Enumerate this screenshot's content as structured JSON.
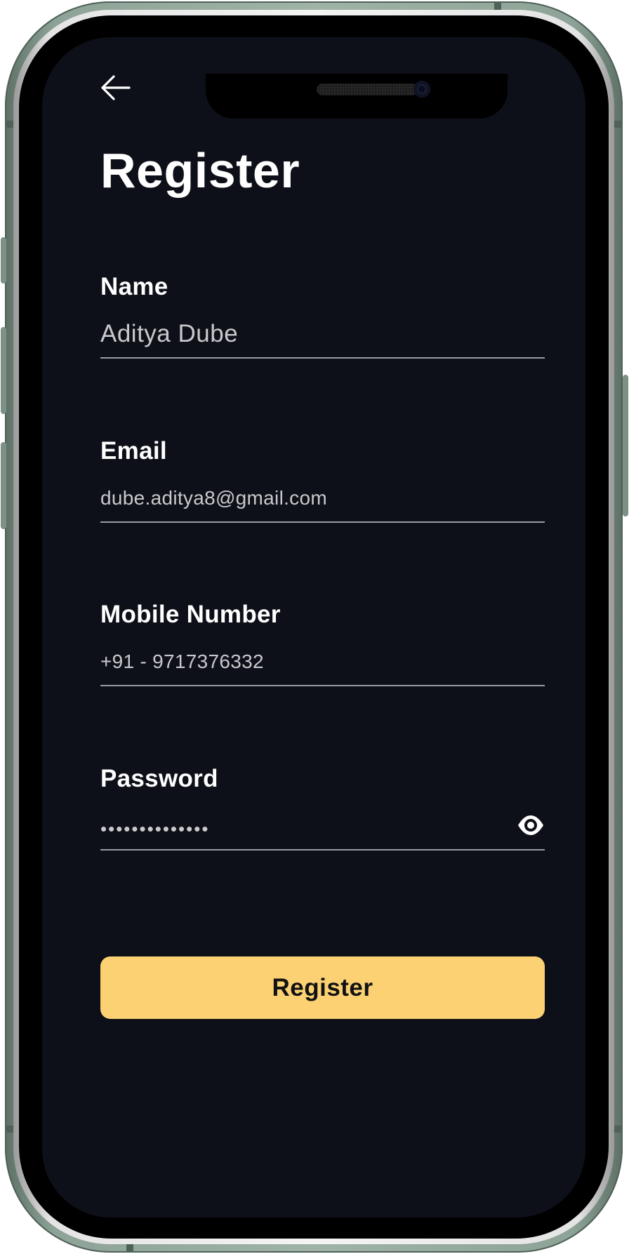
{
  "screen": {
    "title": "Register",
    "back_icon": "arrow-left-icon"
  },
  "form": {
    "name": {
      "label": "Name",
      "value": "Aditya Dube"
    },
    "email": {
      "label": "Email",
      "value": "dube.aditya8@gmail.com"
    },
    "mobile": {
      "label": "Mobile Number",
      "value": "+91 - 9717376332"
    },
    "password": {
      "label": "Password",
      "value": "••••••••••••••",
      "toggle_icon": "eye-icon"
    }
  },
  "actions": {
    "register_label": "Register"
  },
  "colors": {
    "background": "#0e1019",
    "accent": "#fcd173",
    "text": "#ffffff",
    "input_text": "#c9c9cc",
    "underline": "#9a9ca3",
    "frame": "#8ea397"
  }
}
